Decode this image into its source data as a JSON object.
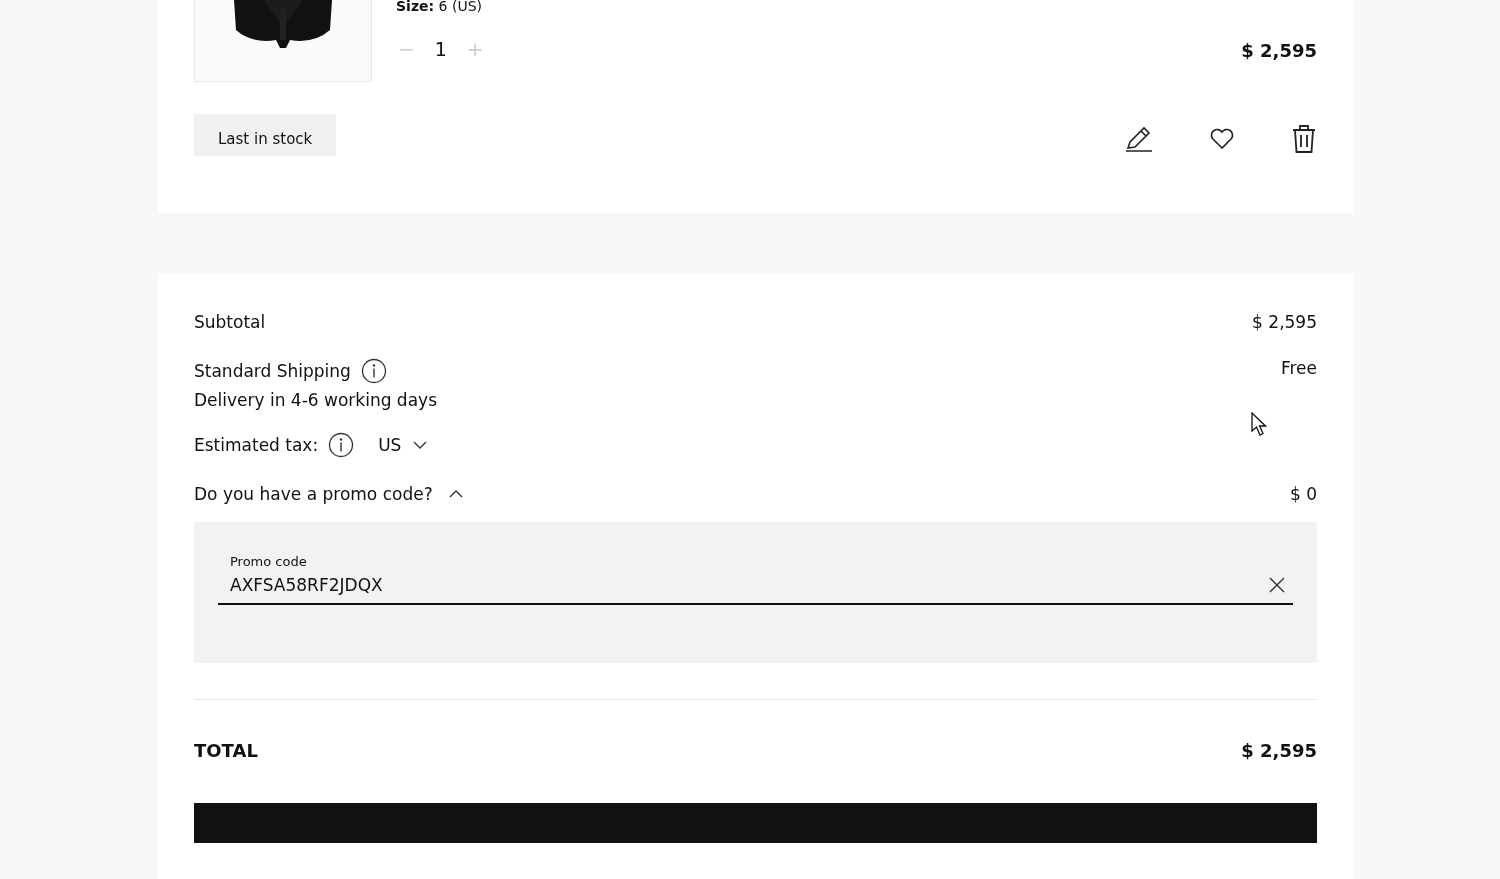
{
  "cart_item": {
    "size_label": "Size:",
    "size_value": "6 (US)",
    "decrease": "−",
    "quantity": "1",
    "increase": "+",
    "price": "$ 2,595",
    "badge": "Last in stock"
  },
  "summary": {
    "subtotal_label": "Subtotal",
    "subtotal_value": "$ 2,595",
    "shipping_label": "Standard Shipping",
    "shipping_value": "Free",
    "shipping_note": "Delivery in 4-6 working days",
    "tax_label": "Estimated tax:",
    "tax_country": "US",
    "promo_label": "Do you have a promo code?",
    "promo_expanded": true,
    "promo_value": "$ 0",
    "promo_field": {
      "label": "Promo code",
      "value": "AXFSA58RF2JDQX"
    },
    "total_label": "TOTAL",
    "total_value": "$ 2,595"
  }
}
